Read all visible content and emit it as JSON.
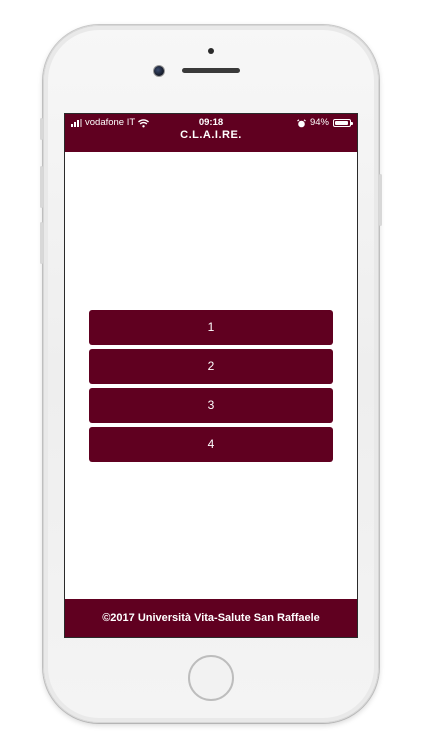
{
  "status_bar": {
    "carrier": "vodafone IT",
    "time": "09:18",
    "battery": "94%",
    "battery_level": 0.94
  },
  "header": {
    "title": "C.L.A.I.RE."
  },
  "menu": {
    "items": [
      {
        "label": "1"
      },
      {
        "label": "2"
      },
      {
        "label": "3"
      },
      {
        "label": "4"
      }
    ]
  },
  "footer": {
    "text": "©2017 Università Vita-Salute San Raffaele"
  },
  "colors": {
    "brand": "#600020",
    "text_on_brand": "#ffffff",
    "background": "#ffffff"
  },
  "icons": {
    "signal": "signal-bars-icon",
    "wifi": "wifi-icon",
    "alarm": "alarm-clock-icon",
    "battery": "battery-icon"
  }
}
